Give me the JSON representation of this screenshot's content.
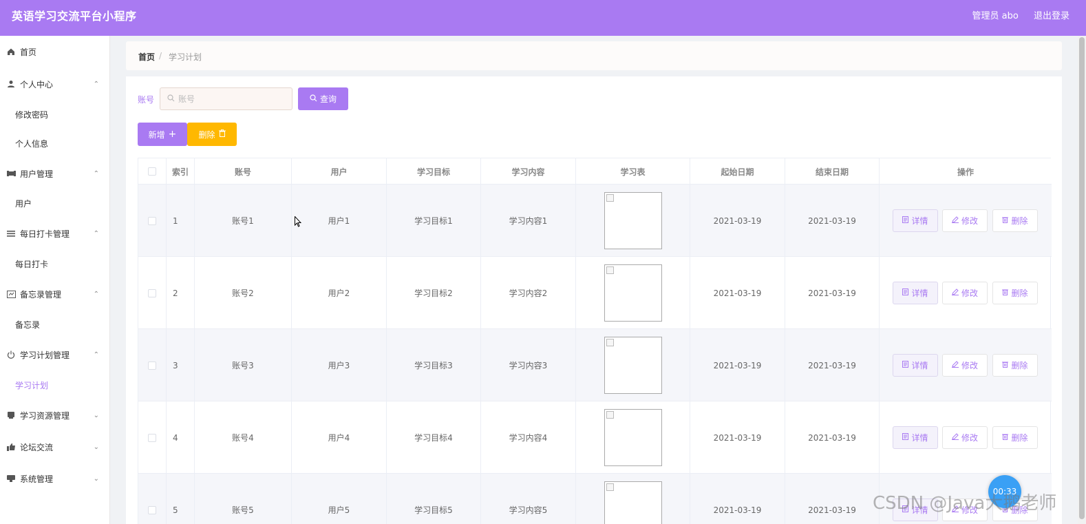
{
  "header": {
    "title": "英语学习交流平台小程序",
    "user": "管理员 abo",
    "logout": "退出登录"
  },
  "sidebar": {
    "items": [
      {
        "label": "首页",
        "icon": "home-icon"
      },
      {
        "label": "个人中心",
        "icon": "user-icon",
        "arrow": "⌃"
      },
      {
        "label": "修改密码"
      },
      {
        "label": "个人信息"
      },
      {
        "label": "用户管理",
        "icon": "users-icon",
        "arrow": "⌃"
      },
      {
        "label": "用户"
      },
      {
        "label": "每日打卡管理",
        "icon": "list-icon",
        "arrow": "⌃"
      },
      {
        "label": "每日打卡"
      },
      {
        "label": "备忘录管理",
        "icon": "memo-icon",
        "arrow": "⌃"
      },
      {
        "label": "备忘录"
      },
      {
        "label": "学习计划管理",
        "icon": "power-icon",
        "arrow": "⌃"
      },
      {
        "label": "学习计划"
      },
      {
        "label": "学习资源管理",
        "icon": "resource-icon",
        "arrow": "⌄"
      },
      {
        "label": "论坛交流",
        "icon": "forum-icon",
        "arrow": "⌄"
      },
      {
        "label": "系统管理",
        "icon": "system-icon",
        "arrow": "⌄"
      }
    ]
  },
  "breadcrumb": {
    "home": "首页",
    "sep": "/",
    "current": "学习计划"
  },
  "search": {
    "label": "账号",
    "placeholder": "账号",
    "button": "查询"
  },
  "actions": {
    "add": "新增",
    "delete": "删除"
  },
  "table": {
    "columns": [
      "索引",
      "账号",
      "用户",
      "学习目标",
      "学习内容",
      "学习表",
      "起始日期",
      "结束日期",
      "操作"
    ],
    "rows": [
      {
        "index": "1",
        "account": "账号1",
        "user": "用户1",
        "goal": "学习目标1",
        "content": "学习内容1",
        "start": "2021-03-19",
        "end": "2021-03-19"
      },
      {
        "index": "2",
        "account": "账号2",
        "user": "用户2",
        "goal": "学习目标2",
        "content": "学习内容2",
        "start": "2021-03-19",
        "end": "2021-03-19"
      },
      {
        "index": "3",
        "account": "账号3",
        "user": "用户3",
        "goal": "学习目标3",
        "content": "学习内容3",
        "start": "2021-03-19",
        "end": "2021-03-19"
      },
      {
        "index": "4",
        "account": "账号4",
        "user": "用户4",
        "goal": "学习目标4",
        "content": "学习内容4",
        "start": "2021-03-19",
        "end": "2021-03-19"
      },
      {
        "index": "5",
        "account": "账号5",
        "user": "用户5",
        "goal": "学习目标5",
        "content": "学习内容5",
        "start": "2021-03-19",
        "end": "2021-03-19"
      }
    ],
    "ops": {
      "detail": "详情",
      "edit": "修改",
      "delete": "删除"
    }
  },
  "overlay": {
    "timer": "00:33",
    "watermark": "CSDN @Java大鹅老师"
  },
  "colors": {
    "primary": "#a97af2",
    "warning": "#ffb800"
  }
}
